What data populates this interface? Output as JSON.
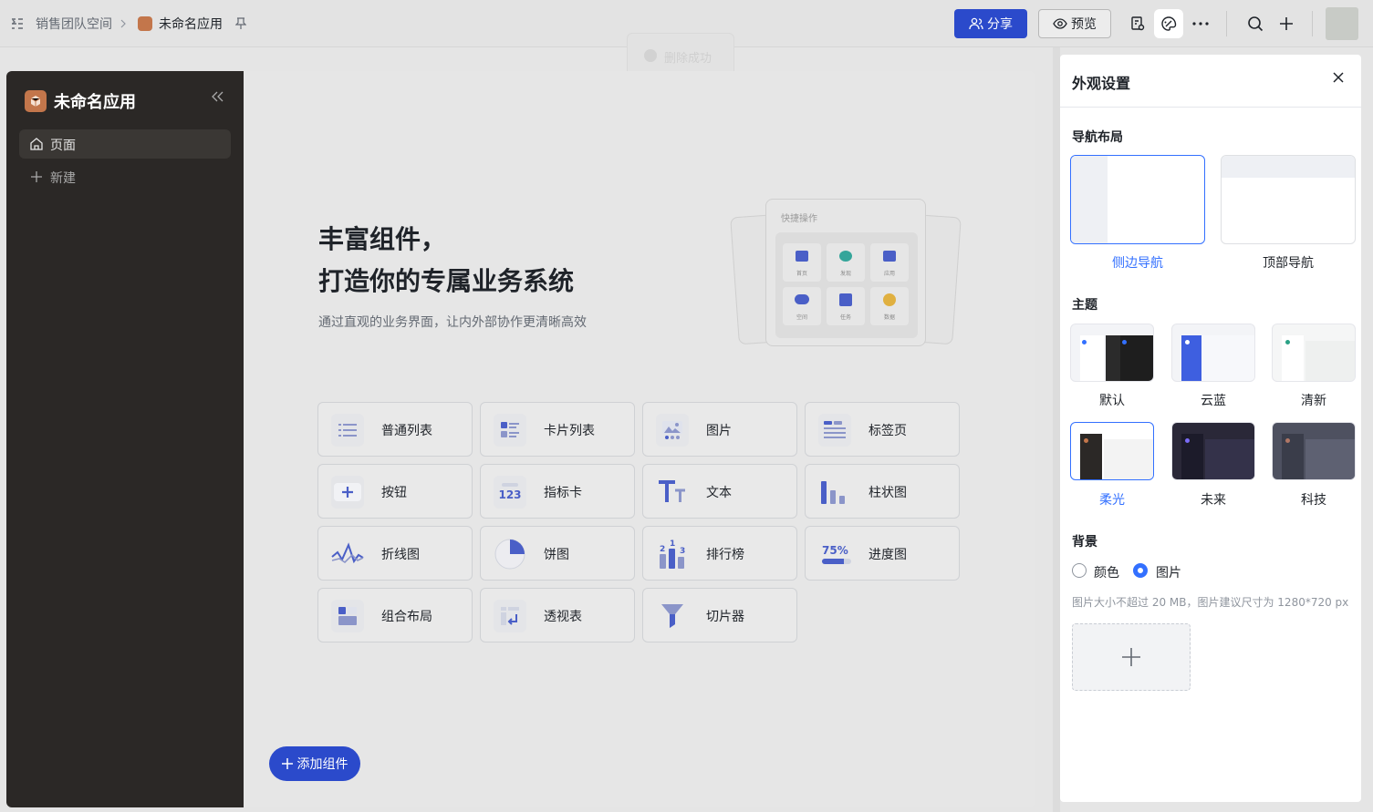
{
  "topbar": {
    "breadcrumb": [
      "销售团队空间",
      "未命名应用"
    ],
    "share_label": "分享",
    "preview_label": "预览"
  },
  "toast": {
    "text": "删除成功"
  },
  "sidebar": {
    "app_name": "未命名应用",
    "items": [
      {
        "label": "页面"
      },
      {
        "label": "新建"
      }
    ]
  },
  "hero": {
    "title_line1": "丰富组件，",
    "title_line2": "打造你的专属业务系统",
    "subtitle": "通过直观的业务界面，让内外部协作更清晰高效"
  },
  "illustration": {
    "header": "快捷操作",
    "tiles": [
      "首页",
      "发现",
      "应用",
      "空间",
      "任务",
      "数据"
    ]
  },
  "components": [
    {
      "label": "普通列表",
      "icon": "list-icon"
    },
    {
      "label": "卡片列表",
      "icon": "card-list-icon"
    },
    {
      "label": "图片",
      "icon": "image-icon"
    },
    {
      "label": "标签页",
      "icon": "tabs-icon"
    },
    {
      "label": "按钮",
      "icon": "button-icon"
    },
    {
      "label": "指标卡",
      "icon": "metric-icon",
      "glyph": "123"
    },
    {
      "label": "文本",
      "icon": "text-icon"
    },
    {
      "label": "柱状图",
      "icon": "bar-chart-icon"
    },
    {
      "label": "折线图",
      "icon": "line-chart-icon"
    },
    {
      "label": "饼图",
      "icon": "pie-chart-icon"
    },
    {
      "label": "排行榜",
      "icon": "ranking-icon"
    },
    {
      "label": "进度图",
      "icon": "progress-icon",
      "glyph": "75%"
    },
    {
      "label": "组合布局",
      "icon": "layout-icon"
    },
    {
      "label": "透视表",
      "icon": "pivot-icon"
    },
    {
      "label": "切片器",
      "icon": "filter-icon"
    }
  ],
  "add_component_label": "添加组件",
  "panel": {
    "title": "外观设置",
    "nav_section": "导航布局",
    "nav_options": [
      "侧边导航",
      "顶部导航"
    ],
    "nav_selected": "侧边导航",
    "theme_section": "主题",
    "themes": [
      "默认",
      "云蓝",
      "清新",
      "柔光",
      "未来",
      "科技"
    ],
    "theme_selected": "柔光",
    "bg_section": "背景",
    "bg_options": [
      "颜色",
      "图片"
    ],
    "bg_selected": "图片",
    "hint": "图片大小不超过 20 MB，图片建议尺寸为 1280*720 px"
  },
  "colors": {
    "accent": "#3370ff",
    "primary_button": "#2b4acb",
    "sidebar_bg": "#2b2826"
  }
}
